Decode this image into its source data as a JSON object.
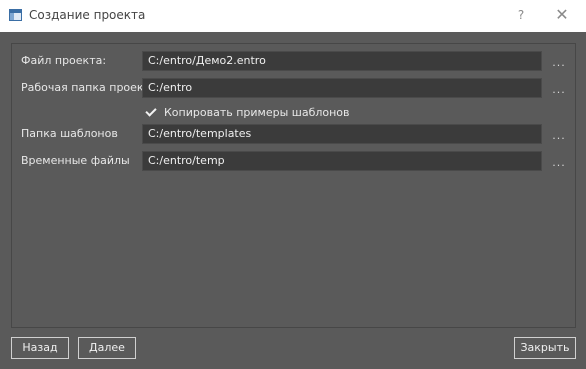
{
  "window": {
    "title": "Создание проекта",
    "help_glyph": "?",
    "close_glyph": "✕",
    "icons": {
      "app": "app-window-icon",
      "help": "help-icon",
      "close": "close-icon"
    }
  },
  "form": {
    "project_file": {
      "label": "Файл проекта:",
      "value": "C:/entro/Демо2.entro"
    },
    "work_folder": {
      "label": "Рабочая папка проекта",
      "value": "C:/entro"
    },
    "copy_templates": {
      "label": "Копировать примеры шаблонов",
      "checked": true
    },
    "templates_folder": {
      "label": "Папка шаблонов",
      "value": "C:/entro/templates"
    },
    "temp_files": {
      "label": "Временные файлы",
      "value": "C:/entro/temp"
    },
    "browse_label": "..."
  },
  "footer": {
    "back_label": "Назад",
    "next_label": "Далее",
    "close_label": "Закрыть"
  },
  "colors": {
    "background": "#5a5a5a",
    "field": "#3b3b3b",
    "titlebar": "#ffffff",
    "text": "#e6e6e6"
  }
}
